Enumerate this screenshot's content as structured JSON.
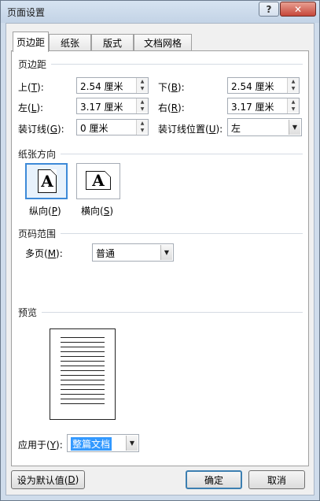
{
  "window": {
    "title": "页面设置",
    "help_glyph": "?",
    "close_glyph": "✕"
  },
  "tabs": [
    {
      "label": "页边距",
      "active": true
    },
    {
      "label": "纸张",
      "active": false
    },
    {
      "label": "版式",
      "active": false
    },
    {
      "label": "文档网格",
      "active": false
    }
  ],
  "margins": {
    "section_title": "页边距",
    "top": {
      "label": "上(",
      "key": "T",
      "suffix": "):",
      "value": "2.54 厘米"
    },
    "bottom": {
      "label": "下(",
      "key": "B",
      "suffix": "):",
      "value": "2.54 厘米"
    },
    "left": {
      "label": "左(",
      "key": "L",
      "suffix": "):",
      "value": "3.17 厘米"
    },
    "right": {
      "label": "右(",
      "key": "R",
      "suffix": "):",
      "value": "3.17 厘米"
    },
    "gutter": {
      "label": "装订线(",
      "key": "G",
      "suffix": "):",
      "value": "0 厘米"
    },
    "gutter_pos": {
      "label": "装订线位置(",
      "key": "U",
      "suffix": "):",
      "value": "左"
    }
  },
  "orientation": {
    "section_title": "纸张方向",
    "portrait": {
      "label": "纵向(",
      "key": "P",
      "suffix": ")",
      "glyph": "A",
      "selected": true
    },
    "landscape": {
      "label": "横向(",
      "key": "S",
      "suffix": ")",
      "glyph": "A",
      "selected": false
    }
  },
  "pages": {
    "section_title": "页码范围",
    "multiple": {
      "label": "多页(",
      "key": "M",
      "suffix": "):",
      "value": "普通"
    }
  },
  "preview": {
    "section_title": "预览",
    "apply_to": {
      "label": "应用于(",
      "key": "Y",
      "suffix": "):",
      "value": "整篇文档"
    }
  },
  "buttons": {
    "set_default": {
      "label": "设为默认值(",
      "key": "D",
      "suffix": ")"
    },
    "ok": {
      "label": "确定"
    },
    "cancel": {
      "label": "取消"
    }
  }
}
